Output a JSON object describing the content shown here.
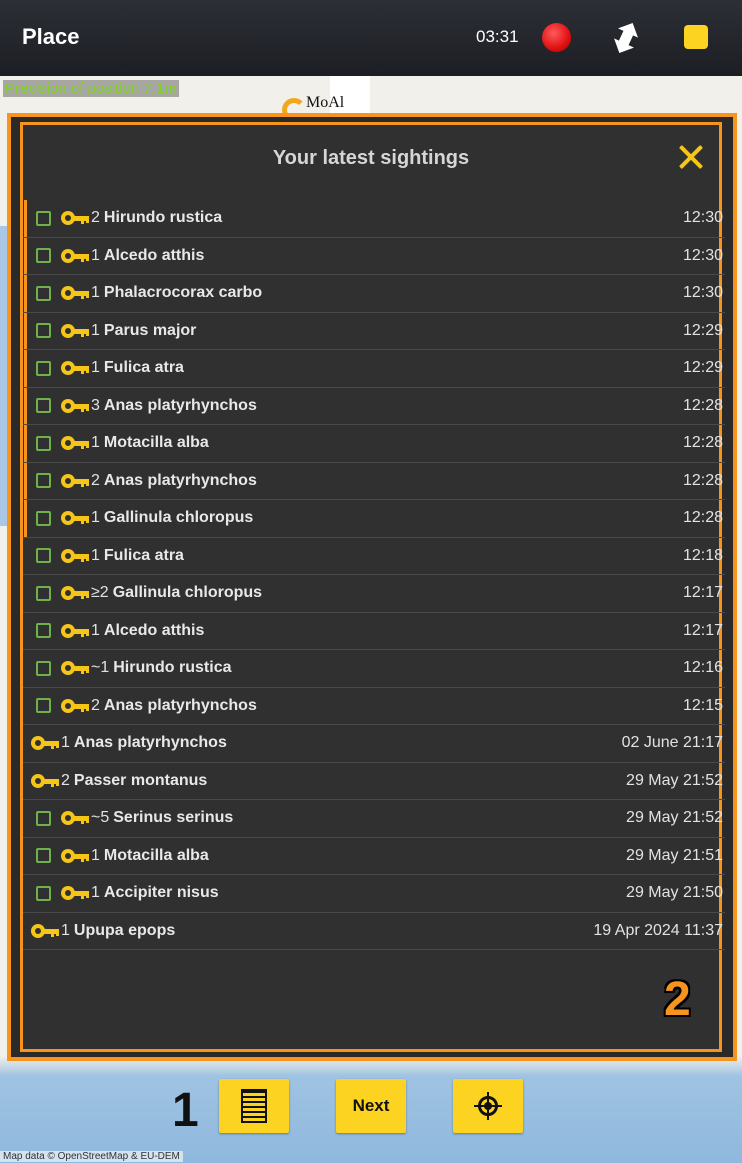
{
  "topbar": {
    "title": "Place",
    "clock": "03:31",
    "precision": "Precision of position 7.1m"
  },
  "map": {
    "place_label": "MoAl",
    "attribution": "Map data © OpenStreetMap & EU-DEM"
  },
  "dialog": {
    "title": "Your latest sightings",
    "annotation_2": "2",
    "sightings": [
      {
        "checkbox": true,
        "marked": true,
        "count": "2",
        "species": "Hirundo rustica",
        "time": "12:30"
      },
      {
        "checkbox": true,
        "marked": true,
        "count": "1",
        "species": "Alcedo atthis",
        "time": "12:30"
      },
      {
        "checkbox": true,
        "marked": true,
        "count": "1",
        "species": "Phalacrocorax carbo",
        "time": "12:30"
      },
      {
        "checkbox": true,
        "marked": true,
        "count": "1",
        "species": "Parus major",
        "time": "12:29"
      },
      {
        "checkbox": true,
        "marked": true,
        "count": "1",
        "species": "Fulica atra",
        "time": "12:29"
      },
      {
        "checkbox": true,
        "marked": true,
        "count": "3",
        "species": "Anas platyrhynchos",
        "time": "12:28"
      },
      {
        "checkbox": true,
        "marked": true,
        "count": "1",
        "species": "Motacilla alba",
        "time": "12:28"
      },
      {
        "checkbox": true,
        "marked": true,
        "count": "2",
        "species": "Anas platyrhynchos",
        "time": "12:28"
      },
      {
        "checkbox": true,
        "marked": true,
        "count": "1",
        "species": "Gallinula chloropus",
        "time": "12:28"
      },
      {
        "checkbox": true,
        "marked": false,
        "count": "1",
        "species": "Fulica atra",
        "time": "12:18"
      },
      {
        "checkbox": true,
        "marked": false,
        "count": "≥2",
        "species": "Gallinula chloropus",
        "time": "12:17"
      },
      {
        "checkbox": true,
        "marked": false,
        "count": "1",
        "species": "Alcedo atthis",
        "time": "12:17"
      },
      {
        "checkbox": true,
        "marked": false,
        "count": "~1",
        "species": "Hirundo rustica",
        "time": "12:16"
      },
      {
        "checkbox": true,
        "marked": false,
        "count": "2",
        "species": "Anas platyrhynchos",
        "time": "12:15"
      },
      {
        "checkbox": false,
        "marked": false,
        "count": "1",
        "species": "Anas platyrhynchos",
        "time": "02 June 21:17"
      },
      {
        "checkbox": false,
        "marked": false,
        "count": "2",
        "species": "Passer montanus",
        "time": "29 May 21:52"
      },
      {
        "checkbox": true,
        "marked": false,
        "count": "~5",
        "species": "Serinus serinus",
        "time": "29 May 21:52"
      },
      {
        "checkbox": true,
        "marked": false,
        "count": "1",
        "species": "Motacilla alba",
        "time": "29 May 21:51"
      },
      {
        "checkbox": true,
        "marked": false,
        "count": "1",
        "species": "Accipiter nisus",
        "time": "29 May 21:50"
      },
      {
        "checkbox": false,
        "marked": false,
        "count": "1",
        "species": "Upupa epops",
        "time": "19 Apr 2024 11:37"
      }
    ]
  },
  "bottom": {
    "annotation_1": "1",
    "next_label": "Next"
  },
  "icons": {
    "record": "record-icon",
    "sync": "sync-arrows-icon",
    "stop": "stop-icon",
    "close": "close-icon",
    "key": "key-icon",
    "list": "list-icon",
    "locate": "locate-icon"
  },
  "colors": {
    "accent_orange": "#f7941d",
    "button_yellow": "#fcd321",
    "key_yellow": "#f5c518",
    "checkbox_green": "#6fb24a",
    "record_red": "#e01010",
    "precision_green": "#7ed321",
    "dialog_bg": "#303030"
  }
}
